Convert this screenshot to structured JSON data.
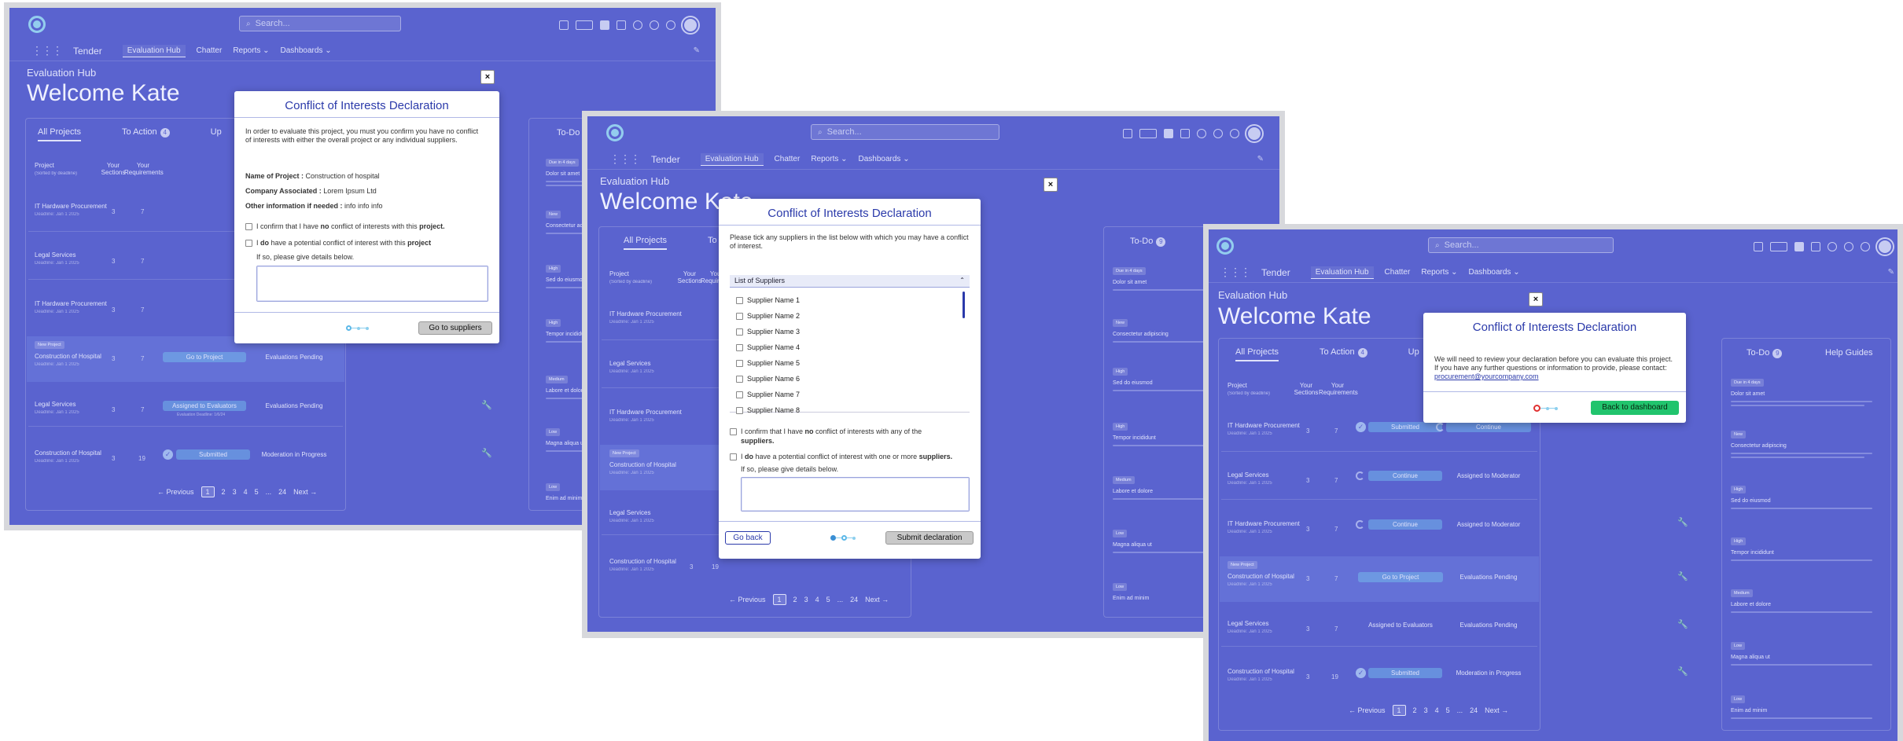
{
  "app": {
    "brand": "Tender",
    "search_placeholder": "Search...",
    "nav": [
      "Evaluation Hub",
      "Chatter",
      "Reports",
      "Dashboards"
    ],
    "section_title": "Evaluation Hub",
    "welcome": "Welcome Kate",
    "tabs": [
      "All Projects",
      "To Action",
      "Up"
    ],
    "to_action_count": "4",
    "table_headers": {
      "project": "Project",
      "sorted": "(Sorted by deadline)",
      "sections": "Your Sections",
      "requirements": "Your Requirements"
    },
    "rows": [
      {
        "name": "IT Hardware Procurement",
        "sub": "Deadline: Jan 1 2025",
        "sections": "3",
        "reqs": "7"
      },
      {
        "name": "Legal Services",
        "sub": "Deadline: Jan 1 2025",
        "sections": "3",
        "reqs": "7"
      },
      {
        "name": "IT Hardware Procurement",
        "sub": "Deadline: Jan 1 2025",
        "sections": "3",
        "reqs": "7"
      },
      {
        "name": "Construction of Hospital",
        "sub": "Deadline: Jan 1 2025",
        "sections": "3",
        "reqs": "7",
        "tag": "New Project"
      },
      {
        "name": "Legal Services",
        "sub": "Deadline: Jan 1 2025",
        "sections": "3",
        "reqs": "7"
      },
      {
        "name": "Construction of Hospital",
        "sub": "Deadline: Jan 1 2025",
        "sections": "3",
        "reqs": "19"
      }
    ],
    "statuses": {
      "submitted": "Submitted",
      "continue": "Continue",
      "go_to_project": "Go to Project",
      "assigned": "Assigned to Evaluators",
      "evals_pending": "Evaluations Pending",
      "assigned_moderator": "Assigned to Moderator",
      "moderation": "Moderation in Progress"
    },
    "pager": {
      "prev": "Previous",
      "pages": [
        "1",
        "2",
        "3",
        "4",
        "5",
        "...",
        "24"
      ],
      "next": "Next"
    },
    "todo": {
      "title": "To-Do",
      "count": "9",
      "help": "Help Guides",
      "items": [
        {
          "tag": "Due in 4 days",
          "title": "Dolor sit amet"
        },
        {
          "tag": "New",
          "title": "Consectetur adipiscing"
        },
        {
          "tag": "High",
          "title": "Sed do eiusmod"
        },
        {
          "tag": "High",
          "title": "Tempor incididunt"
        },
        {
          "tag": "Medium",
          "title": "Labore et dolore"
        },
        {
          "tag": "Low",
          "title": "Magna aliqua ut"
        },
        {
          "tag": "Low",
          "title": "Enim ad minim"
        }
      ]
    }
  },
  "modal1": {
    "title": "Conflict of Interests Declaration",
    "intro": "In order to evaluate this project, you must you confirm you have no conflict of interests with either the overall project or any individual suppliers.",
    "name_label": "Name of Project :",
    "name_value": "Construction of hospital",
    "company_label": "Company Associated :",
    "company_value": "Lorem Ipsum Ltd",
    "other_label": "Other information if needed :",
    "other_value": "info info info",
    "cb1_a": "I confirm that I have ",
    "cb1_b": "no",
    "cb1_c": " conflict of interests with this ",
    "cb1_d": "project.",
    "cb2_a": "I ",
    "cb2_b": "do",
    "cb2_c": " have a potential conflict of interest with this ",
    "cb2_d": "project",
    "details": "If so, please give details below.",
    "button": "Go to suppliers",
    "close": "×"
  },
  "modal2": {
    "title": "Conflict of Interests Declaration",
    "intro": "Please tick any suppliers in the list below with which you may have a conflict of interest.",
    "list_header": "List of Suppliers",
    "suppliers": [
      "Supplier Name 1",
      "Supplier Name 2",
      "Supplier Name 3",
      "Supplier Name 4",
      "Supplier Name 5",
      "Supplier Name 6",
      "Supplier Name 7",
      "Supplier Name 8"
    ],
    "cb1_a": "I confirm that I have ",
    "cb1_b": "no",
    "cb1_c": " conflict of interests with any of the ",
    "cb1_d": "suppliers.",
    "cb2_a": "I ",
    "cb2_b": "do",
    "cb2_c": " have a potential conflict of interest with one or more ",
    "cb2_d": "suppliers.",
    "details": "If so, please give details below.",
    "back": "Go back",
    "submit": "Submit declaration",
    "close": "×"
  },
  "modal3": {
    "title": "Conflict of Interests Declaration",
    "body": "We will need to review your declaration before you can evaluate this project. If you have any further questions or information to provide, please contact: ",
    "email": "procurement@yourcompany.com",
    "button": "Back to dashboard",
    "close": "×"
  },
  "colors": {
    "overlay": "#5a63cf",
    "title": "#2b3aaa",
    "green": "#21c46d",
    "step": "#5cb8e8"
  }
}
